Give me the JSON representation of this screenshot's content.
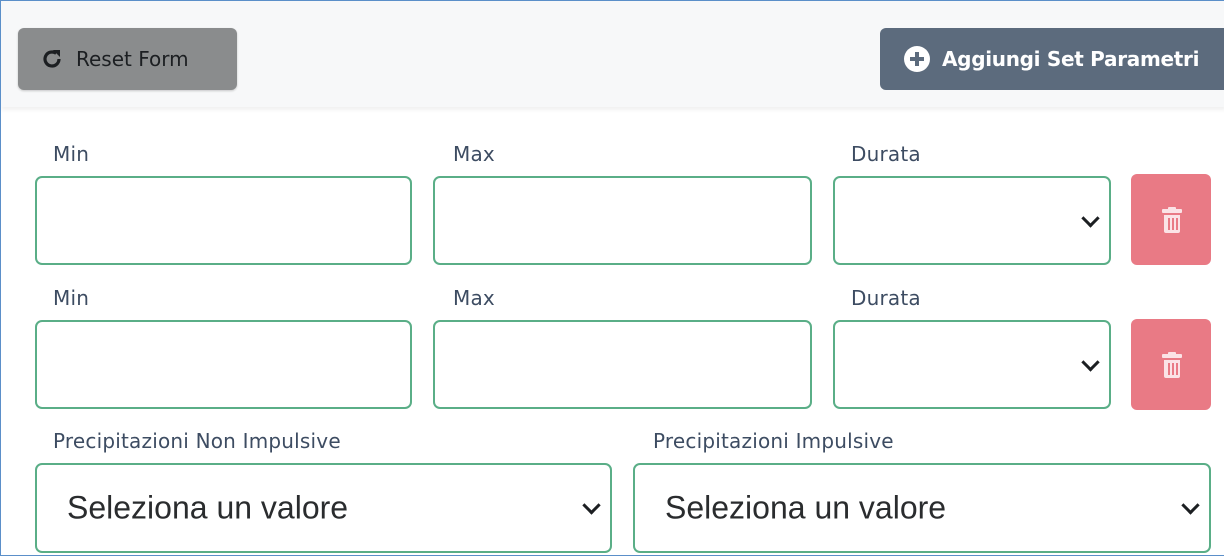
{
  "toolbar": {
    "reset_label": "Reset Form",
    "add_label": "Aggiungi Set Parametri"
  },
  "rows": [
    {
      "min_label": "Min",
      "max_label": "Max",
      "durata_label": "Durata",
      "min_value": "",
      "max_value": "",
      "durata_value": ""
    },
    {
      "min_label": "Min",
      "max_label": "Max",
      "durata_label": "Durata",
      "min_value": "",
      "max_value": "",
      "durata_value": ""
    }
  ],
  "precipitazioni": {
    "non_impulsive_label": "Precipitazioni Non Impulsive",
    "non_impulsive_value": "Seleziona un valore",
    "impulsive_label": "Precipitazioni Impulsive",
    "impulsive_value": "Seleziona un valore"
  },
  "icons": {
    "reset": "refresh-icon",
    "add": "plus-circle-icon",
    "delete": "trash-icon",
    "dropdown": "chevron-down-icon"
  },
  "colors": {
    "field_border": "#5aae87",
    "label": "#3d4c62",
    "reset_bg": "#8a8c8d",
    "add_bg": "#5c6b7d",
    "delete_bg": "#e97a85"
  }
}
